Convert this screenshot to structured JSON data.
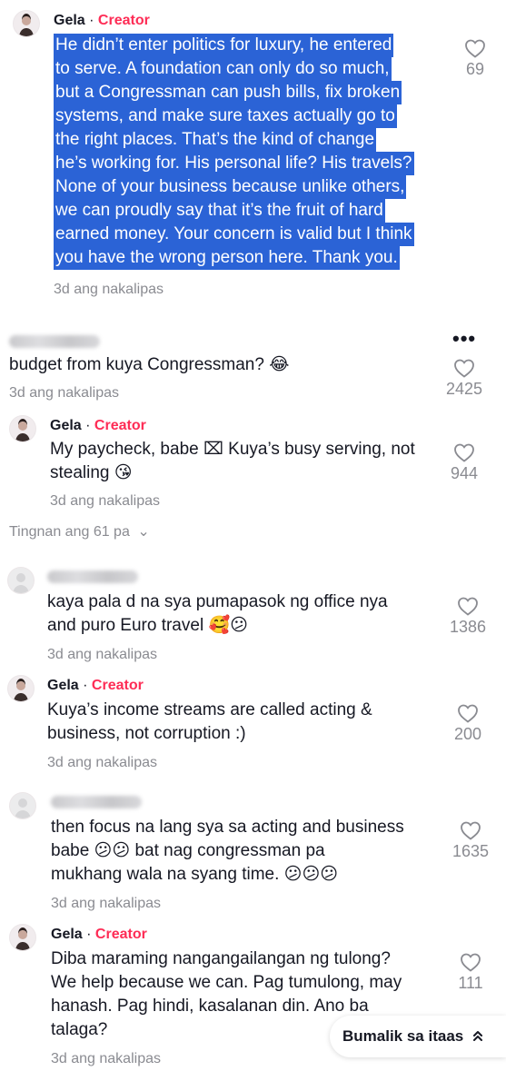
{
  "comments": [
    {
      "username": "Gela",
      "separator": "·",
      "badge": "Creator",
      "lines": [
        "He didn’t enter politics for luxury, he entered",
        "to serve. A foundation can only do so much,",
        "but a Congressman can push bills, fix broken",
        "systems, and make sure taxes actually go to",
        "the right places. That’s the kind of change",
        "he’s working for. His personal life? His travels?",
        "None of your business because unlike others,",
        "we can proudly say that it’s the fruit of hard",
        "earned money. Your concern is valid but I think",
        "you have the wrong person here. Thank you."
      ],
      "time": "3d ang nakalipas",
      "likes": "69"
    },
    {
      "lines": [
        "budget from kuya Congressman? 😂"
      ],
      "time": "3d ang nakalipas",
      "likes": "2425"
    },
    {
      "username": "Gela",
      "separator": "·",
      "badge": "Creator",
      "lines": [
        "My paycheck, babe ⌧ Kuya’s busy serving, not",
        "stealing 😘"
      ],
      "time": "3d ang nakalipas",
      "likes": "944"
    },
    {
      "lines": [
        "kaya pala d na sya pumapasok ng office nya",
        "and puro Euro travel 🥰😕"
      ],
      "time": "3d ang nakalipas",
      "likes": "1386"
    },
    {
      "username": "Gela",
      "separator": "·",
      "badge": "Creator",
      "lines": [
        "Kuya’s income streams are called acting &",
        "business, not corruption :)"
      ],
      "time": "3d ang nakalipas",
      "likes": "200"
    },
    {
      "lines": [
        "then focus na lang sya sa acting and business",
        "babe 😕😕 bat nag congressman pa",
        "mukhang wala na syang time. 😕😕😕"
      ],
      "time": "3d ang nakalipas",
      "likes": "1635"
    },
    {
      "username": "Gela",
      "separator": "·",
      "badge": "Creator",
      "lines": [
        "Diba maraming nangangailangan ng tulong?",
        "We help because we can. Pag tumulong, may",
        "hanash. Pag hindi, kasalanan din. Ano ba",
        "talaga?"
      ],
      "time": "3d ang nakalipas",
      "likes": "111"
    }
  ],
  "view_more": {
    "label": "Tingnan ang 61 pa",
    "chevron": "⌄"
  },
  "more_options": "•••",
  "back_to_top": {
    "label": "Bumalik sa itaas",
    "icon": "⌃⌃"
  },
  "colors": {
    "creator": "#fe2c55",
    "selection": "#2b63d6",
    "muted": "#8a8b91"
  }
}
